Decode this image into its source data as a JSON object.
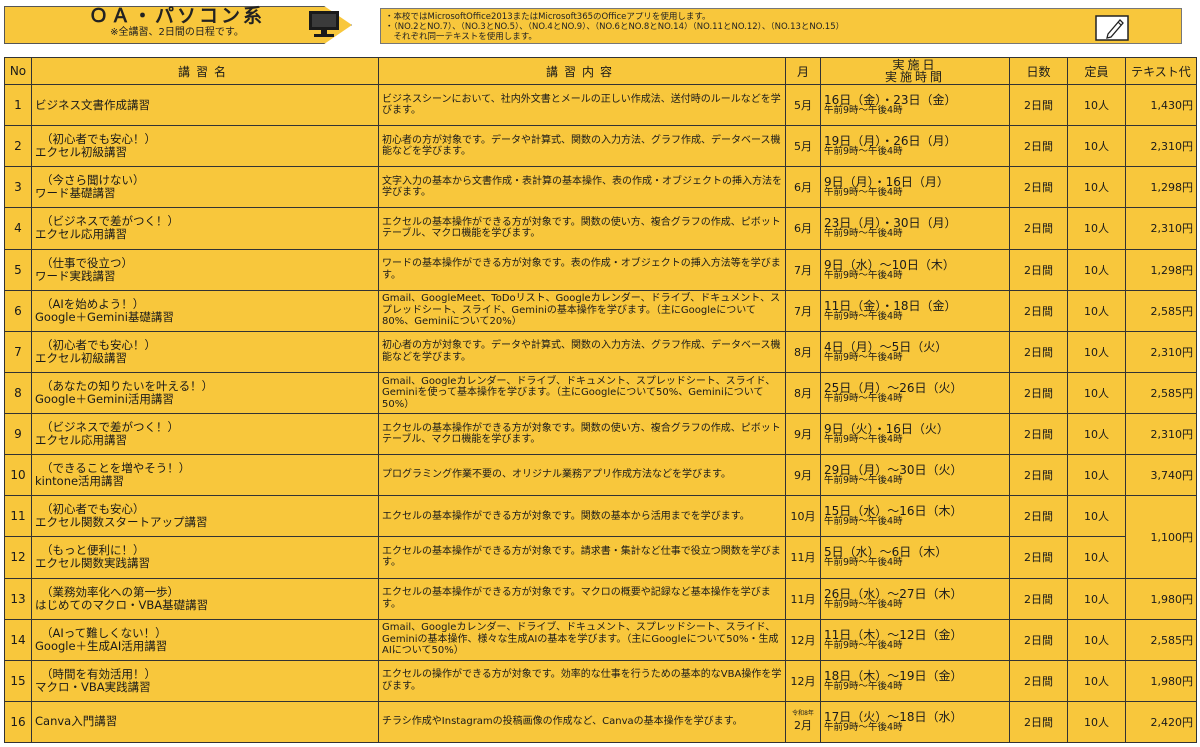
{
  "header": {
    "title": "ＯＡ・パソコン系",
    "subtitle": "※全講習、2日間の日程です。",
    "notes": [
      "・本校ではMicrosoftOffice2013またはMicrosoft365のOfficeアプリを使用します。",
      "・（NO.2とNO.7）、（NO.3とNO.5）、（NO.4とNO.9）、（NO.6とNO.8とNO.14）（NO.11とNO.12）、（NO.13とNO.15）",
      "　それぞれ同一テキストを使用します。"
    ],
    "accent_color": "#f8c73c"
  },
  "table": {
    "headers": {
      "no": "No",
      "name": "講習名",
      "content": "講習内容",
      "month": "月",
      "date_line1": "実施日",
      "date_line2": "実施時間",
      "days": "日数",
      "capacity": "定員",
      "fee": "テキスト代"
    },
    "rows": [
      {
        "no": "1",
        "name_sub": "",
        "name": "ビジネス文書作成講習",
        "content": "ビジネスシーンにおいて、社内外文書とメールの正しい作成法、送付時のルールなどを学びます。",
        "month_era": "",
        "month": "5月",
        "date": "16日（金）・23日（金）",
        "time": "午前9時〜午後4時",
        "days": "2日間",
        "capacity": "10人",
        "fee": "1,430円"
      },
      {
        "no": "2",
        "name_sub": "（初心者でも安心！）",
        "name": "エクセル初級講習",
        "content": "初心者の方が対象です。データや計算式、関数の入力方法、グラフ作成、データベース機能などを学びます。",
        "month_era": "",
        "month": "5月",
        "date": "19日（月）・26日（月）",
        "time": "午前9時〜午後4時",
        "days": "2日間",
        "capacity": "10人",
        "fee": "2,310円"
      },
      {
        "no": "3",
        "name_sub": "（今さら聞けない）",
        "name": "ワード基礎講習",
        "content": "文字入力の基本から文書作成・表計算の基本操作、表の作成・オブジェクトの挿入方法を学びます。",
        "month_era": "",
        "month": "6月",
        "date": "9日（月）・16日（月）",
        "time": "午前9時〜午後4時",
        "days": "2日間",
        "capacity": "10人",
        "fee": "1,298円"
      },
      {
        "no": "4",
        "name_sub": "（ビジネスで差がつく！）",
        "name": "エクセル応用講習",
        "content": "エクセルの基本操作ができる方が対象です。関数の使い方、複合グラフの作成、ピボットテーブル、マクロ機能を学びます。",
        "month_era": "",
        "month": "6月",
        "date": "23日（月）・30日（月）",
        "time": "午前9時〜午後4時",
        "days": "2日間",
        "capacity": "10人",
        "fee": "2,310円"
      },
      {
        "no": "5",
        "name_sub": "（仕事で役立つ）",
        "name": "ワード実践講習",
        "content": "ワードの基本操作ができる方が対象です。表の作成・オブジェクトの挿入方法等を学びます。",
        "month_era": "",
        "month": "7月",
        "date": "9日（水）〜10日（木）",
        "time": "午前9時〜午後4時",
        "days": "2日間",
        "capacity": "10人",
        "fee": "1,298円"
      },
      {
        "no": "6",
        "name_sub": "（AIを始めよう！）",
        "name": "Google＋Gemini基礎講習",
        "content": "Gmail、GoogleMeet、ToDoリスト、Googleカレンダー、ドライブ、ドキュメント、スプレッドシート、スライド、Geminiの基本操作を学びます。（主にGoogleについて80%、Geminiについて20%）",
        "month_era": "",
        "month": "7月",
        "date": "11日（金）・18日（金）",
        "time": "午前9時〜午後4時",
        "days": "2日間",
        "capacity": "10人",
        "fee": "2,585円"
      },
      {
        "no": "7",
        "name_sub": "（初心者でも安心！）",
        "name": "エクセル初級講習",
        "content": "初心者の方が対象です。データや計算式、関数の入力方法、グラフ作成、データベース機能などを学びます。",
        "month_era": "",
        "month": "8月",
        "date": "4日（月）〜5日（火）",
        "time": "午前9時〜午後4時",
        "days": "2日間",
        "capacity": "10人",
        "fee": "2,310円"
      },
      {
        "no": "8",
        "name_sub": "（あなたの知りたいを叶える！）",
        "name": "Google＋Gemini活用講習",
        "content": "Gmail、Googleカレンダー、ドライブ、ドキュメント、スプレッドシート、スライド、Geminiを使って基本操作を学びます。（主にGoogleについて50%、Geminiについて50%）",
        "month_era": "",
        "month": "8月",
        "date": "25日（月）〜26日（火）",
        "time": "午前9時〜午後4時",
        "days": "2日間",
        "capacity": "10人",
        "fee": "2,585円"
      },
      {
        "no": "9",
        "name_sub": "（ビジネスで差がつく！）",
        "name": "エクセル応用講習",
        "content": "エクセルの基本操作ができる方が対象です。関数の使い方、複合グラフの作成、ピボットテーブル、マクロ機能を学びます。",
        "month_era": "",
        "month": "9月",
        "date": "9日（火）・16日（火）",
        "time": "午前9時〜午後4時",
        "days": "2日間",
        "capacity": "10人",
        "fee": "2,310円"
      },
      {
        "no": "10",
        "name_sub": "（できることを増やそう！）",
        "name": "kintone活用講習",
        "content": "プログラミング作業不要の、オリジナル業務アプリ作成方法などを学びます。",
        "month_era": "",
        "month": "9月",
        "date": "29日（月）〜30日（火）",
        "time": "午前9時〜午後4時",
        "days": "2日間",
        "capacity": "10人",
        "fee": "3,740円"
      },
      {
        "no": "11",
        "name_sub": "（初心者でも安心）",
        "name": "エクセル関数スタートアップ講習",
        "content": "エクセルの基本操作ができる方が対象です。関数の基本から活用までを学びます。",
        "month_era": "",
        "month": "10月",
        "date": "15日（水）〜16日（木）",
        "time": "午前9時〜午後4時",
        "days": "2日間",
        "capacity": "10人",
        "fee": "1,100円"
      },
      {
        "no": "12",
        "name_sub": "（もっと便利に！）",
        "name": "エクセル関数実践講習",
        "content": "エクセルの基本操作ができる方が対象です。請求書・集計など仕事で役立つ関数を学びます。",
        "month_era": "",
        "month": "11月",
        "date": "5日（水）〜6日（木）",
        "time": "午前9時〜午後4時",
        "days": "2日間",
        "capacity": "10人",
        "fee": ""
      },
      {
        "no": "13",
        "name_sub": "（業務効率化への第一歩）",
        "name": "はじめてのマクロ・VBA基礎講習",
        "content": "エクセルの基本操作ができる方が対象です。マクロの概要や記録など基本操作を学びます。",
        "month_era": "",
        "month": "11月",
        "date": "26日（水）〜27日（木）",
        "time": "午前9時〜午後4時",
        "days": "2日間",
        "capacity": "10人",
        "fee": "1,980円"
      },
      {
        "no": "14",
        "name_sub": "（AIって難しくない！）",
        "name": "Google＋生成AI活用講習",
        "content": "Gmail、Googleカレンダー、ドライブ、ドキュメント、スプレッドシート、スライド、Geminiの基本操作、様々な生成AIの基本を学びます。（主にGoogleについて50%・生成AIについて50%）",
        "month_era": "",
        "month": "12月",
        "date": "11日（木）〜12日（金）",
        "time": "午前9時〜午後4時",
        "days": "2日間",
        "capacity": "10人",
        "fee": "2,585円"
      },
      {
        "no": "15",
        "name_sub": "（時間を有効活用！）",
        "name": "マクロ・VBA実践講習",
        "content": "エクセルの操作ができる方が対象です。効率的な仕事を行うための基本的なVBA操作を学びます。",
        "month_era": "",
        "month": "12月",
        "date": "18日（木）〜19日（金）",
        "time": "午前9時〜午後4時",
        "days": "2日間",
        "capacity": "10人",
        "fee": "1,980円"
      },
      {
        "no": "16",
        "name_sub": "",
        "name": "Canva入門講習",
        "content": "チラシ作成やInstagramの投稿画像の作成など、Canvaの基本操作を学びます。",
        "month_era": "令和8年",
        "month": "2月",
        "date": "17日（火）〜18日（水）",
        "time": "午前9時〜午後4時",
        "days": "2日間",
        "capacity": "10人",
        "fee": "2,420円"
      }
    ]
  }
}
